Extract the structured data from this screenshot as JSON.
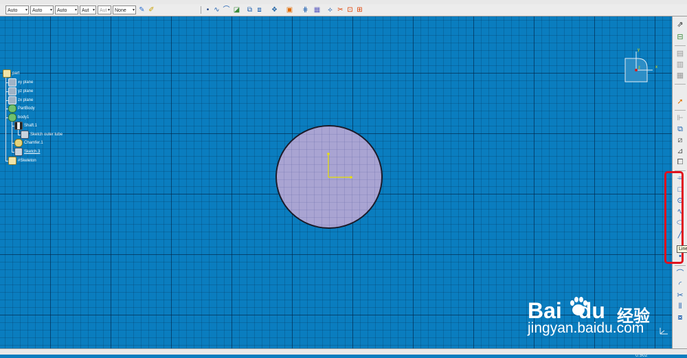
{
  "toolbar": {
    "combos": [
      {
        "name": "line-color-combo",
        "value": "Auto"
      },
      {
        "name": "line-width-combo",
        "value": "Auto"
      },
      {
        "name": "line-type-combo",
        "value": "Auto"
      },
      {
        "name": "point-type-combo",
        "value": "Aut"
      },
      {
        "name": "layer-combo",
        "value": "Aut",
        "disabled": true
      },
      {
        "name": "render-style-combo",
        "value": "None"
      }
    ],
    "icons": [
      "painter-icon",
      "format-icon",
      "point-icon",
      "spline-icon",
      "surface-icon",
      "bracket-icon",
      "select-3d-icon",
      "select-box-icon",
      "explode-icon",
      "block-icon",
      "grid-icon",
      "snap-icon",
      "constraint-icon",
      "cut-icon",
      "dimension-icon"
    ]
  },
  "tree": {
    "items": [
      {
        "label": "part",
        "icon": "part-icon"
      },
      {
        "label": "xy plane",
        "icon": "plane-icon"
      },
      {
        "label": "yz plane",
        "icon": "plane-icon"
      },
      {
        "label": "zx plane",
        "icon": "plane-icon"
      },
      {
        "label": "PartBody",
        "icon": "body-icon"
      },
      {
        "label": "body1",
        "icon": "body-icon"
      },
      {
        "label": "Shaft.1",
        "icon": "shaft-icon"
      },
      {
        "label": "Sketch outer tube",
        "icon": "sketch-icon"
      },
      {
        "label": "Chamfer.1",
        "icon": "chamfer-icon"
      },
      {
        "label": "Sketch.3",
        "icon": "sketch-icon",
        "underline": true
      },
      {
        "label": "#Skeleton",
        "icon": "skeleton-icon"
      }
    ]
  },
  "compass": {
    "axis_y": "y",
    "axis_x": "x",
    "axis_z": "z"
  },
  "rightbar": {
    "tools": [
      "exit-workbench-icon",
      "sketch-icon",
      "cut-part-icon",
      "layer-icon",
      "select-icon",
      "constraint-icon",
      "profile-icon",
      "rectangle-icon",
      "circle-icon",
      "spline-icon",
      "ellipse-icon",
      "line-icon",
      "point-icon",
      "corner-icon",
      "chamfer-icon",
      "trim-icon",
      "mirror-icon",
      "project-icon"
    ],
    "tooltip": "Line"
  },
  "canvas": {
    "scale_label": "0.902"
  },
  "watermark": {
    "logo_left": "Bai",
    "logo_right": "du",
    "brand_cn": "经验",
    "url": "jingyan.baidu.com"
  },
  "colors": {
    "background": "#0a7dbf",
    "sketch_fill": "#a9a4d2",
    "axis": "#e8e000",
    "highlight": "#e0101d"
  }
}
